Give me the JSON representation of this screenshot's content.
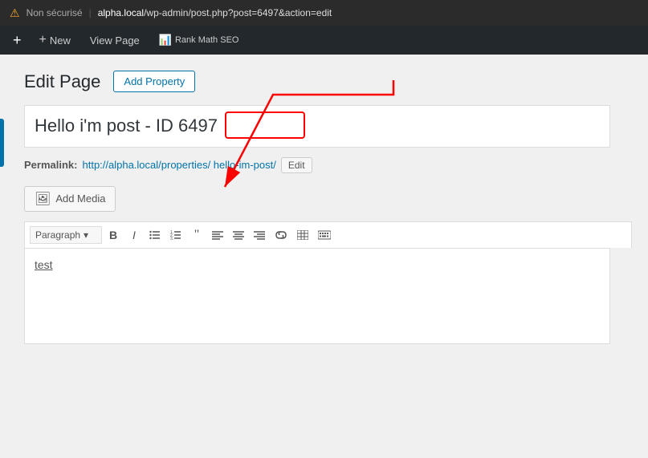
{
  "browser": {
    "warning_icon": "⚠",
    "non_secure_label": "Non sécurisé",
    "separator": "|",
    "url_domain": "alpha.local",
    "url_path": "/wp-admin/post.php?post=6497&action=edit"
  },
  "admin_bar": {
    "wp_logo": "+",
    "items": [
      {
        "label": "New",
        "icon": "+"
      },
      {
        "label": "View Page"
      },
      {
        "label": "Rank Math SEO",
        "has_icon": true
      }
    ]
  },
  "page": {
    "title": "Edit Page",
    "add_property_label": "Add Property",
    "post_title": "Hello i'm post - ID 6497",
    "post_title_plain": "Hello i'm post - ",
    "post_id": "ID 6497",
    "permalink_label": "Permalink:",
    "permalink_url": "http://alpha.local/properties/ hello-im-post/",
    "permalink_url_display": "http://alpha.local/properties/ hello-im-post/",
    "edit_btn_label": "Edit",
    "add_media_label": "Add Media",
    "toolbar": {
      "paragraph_label": "Paragraph",
      "buttons": [
        "B",
        "I",
        "≡",
        "≡",
        "❝",
        "≡",
        "≡",
        "≡",
        "🔗",
        "⊞",
        "⊟"
      ]
    },
    "editor_content": "test"
  }
}
